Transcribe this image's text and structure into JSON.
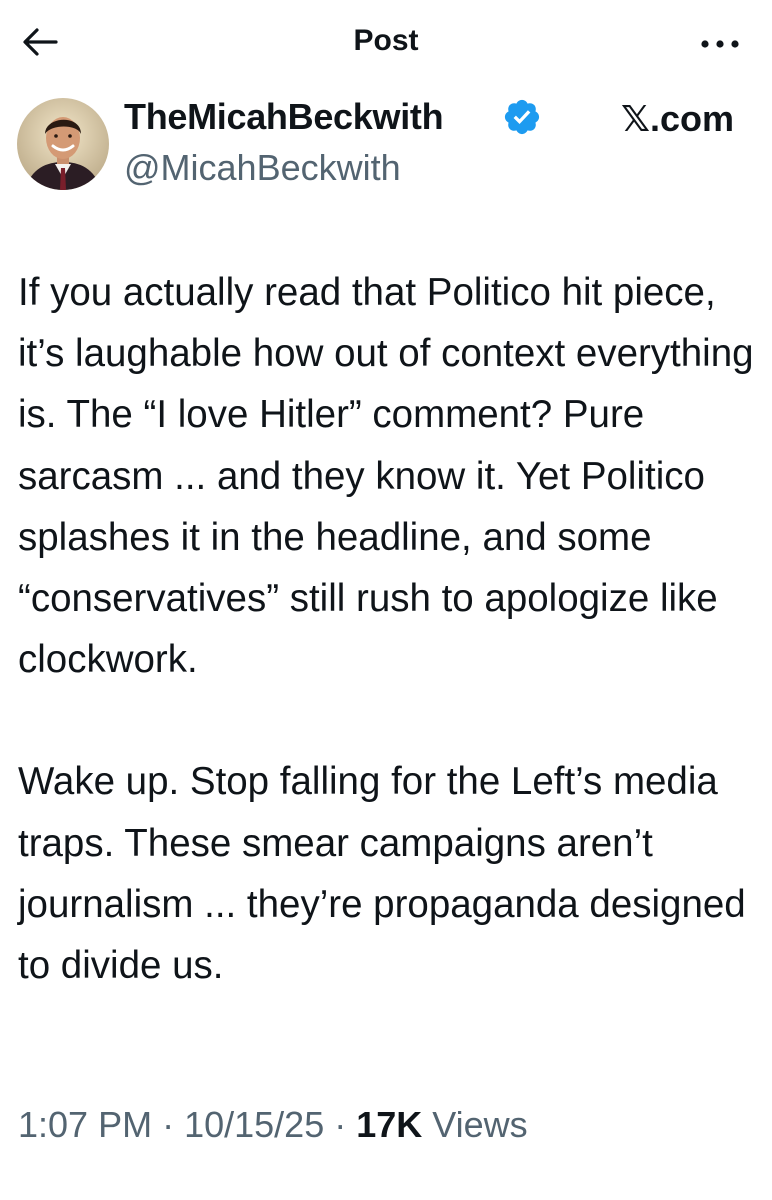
{
  "header": {
    "title": "Post",
    "back_icon": "arrow-left-icon",
    "more_icon": "more-horizontal-icon"
  },
  "author": {
    "display_name": "TheMicahBeckwith",
    "handle": "@MicahBeckwith",
    "verified_icon": "verified-badge-icon",
    "verified_color": "#1d9bf0"
  },
  "watermark": "𝕏.com",
  "post": {
    "paragraph_1": "If you actually read that Politico hit piece, it’s laughable how out of context everything is. The “I love Hitler” comment? Pure sarcasm ... and they know it. Yet Politico splashes it in the headline, and some “conservatives” still rush to apologize like clockwork.",
    "paragraph_2": "Wake up. Stop falling for the Left’s media traps. These smear campaigns aren’t journalism ... they’re propaganda designed to divide us."
  },
  "meta": {
    "time": "1:07 PM",
    "separator": " · ",
    "date": "10/15/25",
    "views_count": "17K",
    "views_label": "Views"
  },
  "colors": {
    "text": "#0f1419",
    "secondary": "#536471",
    "accent": "#1d9bf0"
  }
}
